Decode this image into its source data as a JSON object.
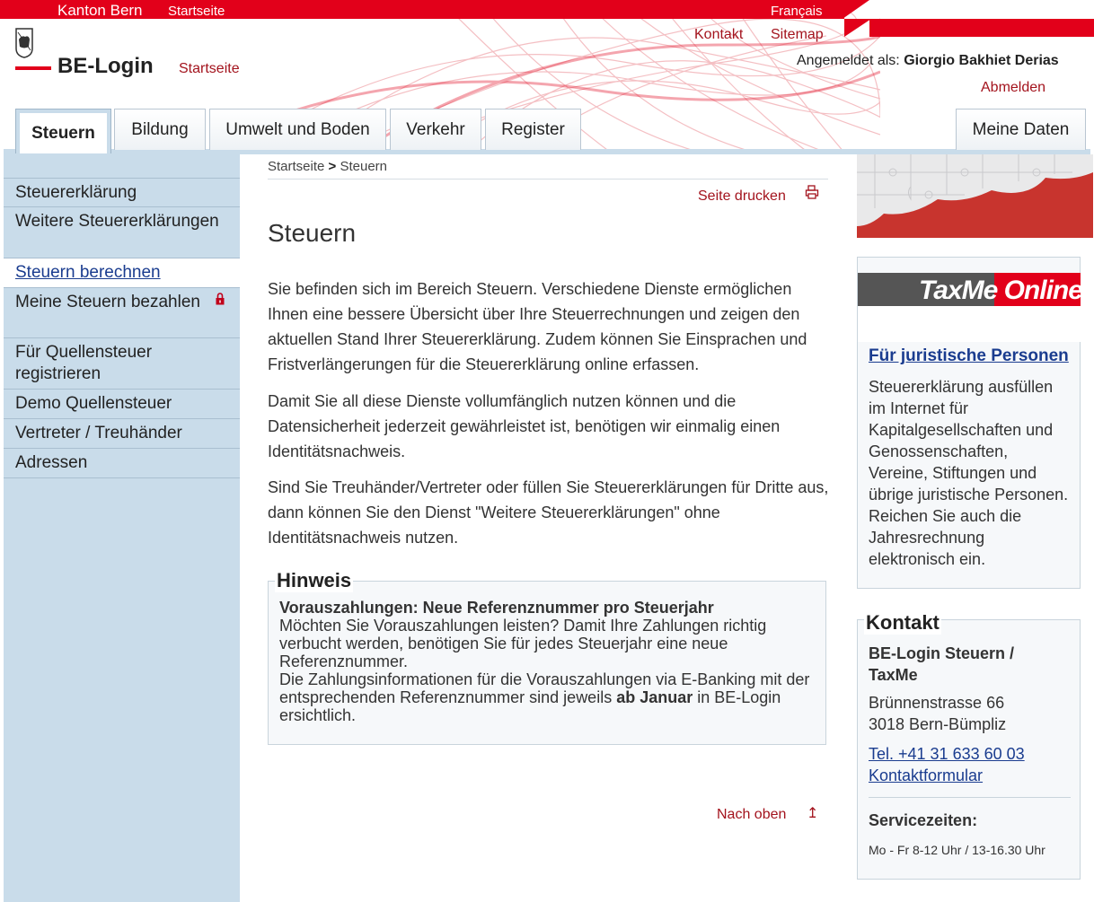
{
  "topbar": {
    "kanton": "Kanton Bern",
    "startseite": "Startseite",
    "language": "Français"
  },
  "header": {
    "brand": "BE-Login",
    "brand_start": "Startseite",
    "kontakt": "Kontakt",
    "sitemap": "Sitemap",
    "logged_in_label": "Angemeldet als:",
    "user_name": "Giorgio Bakhiet Derias",
    "logout": "Abmelden"
  },
  "tabs": [
    {
      "label": "Steuern",
      "active": true
    },
    {
      "label": "Bildung"
    },
    {
      "label": "Umwelt und Boden"
    },
    {
      "label": "Verkehr"
    },
    {
      "label": "Register"
    }
  ],
  "tab_right": {
    "label": "Meine Daten"
  },
  "sidebar": {
    "items": [
      {
        "label": "Steuererklärung"
      },
      {
        "label": "Weitere Steuererklärungen"
      },
      {
        "label": "Steuern berechnen",
        "current": true
      },
      {
        "label": "Meine Steuern bezahlen",
        "locked": true
      },
      {
        "label": "Für Quellensteuer registrieren"
      },
      {
        "label": "Demo Quellensteuer"
      },
      {
        "label": "Vertreter / Treuhänder"
      },
      {
        "label": "Adressen"
      }
    ]
  },
  "main": {
    "breadcrumb": {
      "home": "Startseite",
      "separator": ">",
      "current": "Steuern"
    },
    "print": "Seite drucken",
    "title": "Steuern",
    "paragraphs": [
      "Sie befinden sich im Bereich Steuern. Verschiedene Dienste ermöglichen Ihnen eine bessere Übersicht über Ihre Steuerrechnungen und zeigen den aktuellen Stand Ihrer Steuererklärung. Zudem können Sie Einsprachen und Fristverlängerungen für die Steuererklärung online erfassen.",
      "Damit Sie all diese Dienste vollumfänglich nutzen können und die Datensicherheit jederzeit gewährleistet ist, benötigen wir einmalig einen Identitätsnachweis.",
      "Sind Sie Treuhänder/Vertreter oder füllen Sie Steuererklärungen für Dritte aus, dann können Sie den Dienst \"Weitere Steuererklärungen\" ohne Identitätsnachweis nutzen."
    ],
    "hinweis": {
      "title": "Hinweis",
      "heading": "Vorauszahlungen: Neue Referenznummer pro Steuerjahr",
      "text1": "Möchten Sie Vorauszahlungen leisten? Damit Ihre Zahlungen richtig verbucht werden, benötigen Sie für jedes Steuerjahr eine neue Referenznummer.",
      "text2_before": "Die Zahlungsinformationen für die Vorauszahlungen via E-Banking mit der entsprechenden Referenznummer sind jeweils ",
      "text2_bold": "ab Januar",
      "text2_after": " in BE-Login ersichtlich."
    },
    "back_to_top": "Nach oben"
  },
  "right": {
    "taxme_banner": "TaxMe Online",
    "taxme_link": "Für juristische Personen",
    "taxme_text": "Steuererklärung ausfüllen im Internet für Kapitalgesellschaften und Genossenschaften, Vereine, Stiftungen und übrige juristische Personen. Reichen Sie auch die Jahresrechnung elektronisch ein.",
    "kontakt": {
      "title": "Kontakt",
      "name": "BE-Login Steuern / TaxMe",
      "street": "Brünnenstrasse 66",
      "city": "3018 Bern-Bümpliz",
      "phone": "Tel. +41 31 633 60 03",
      "form": "Kontaktformular",
      "service_label": "Servicezeiten:",
      "hours": "Mo - Fr 8-12 Uhr / 13-16.30 Uhr"
    }
  },
  "colors": {
    "brand_red": "#e2001a",
    "link_red": "#a3131d",
    "link_blue": "#1a3c8f",
    "sidebar_bg": "#c9dcea"
  }
}
